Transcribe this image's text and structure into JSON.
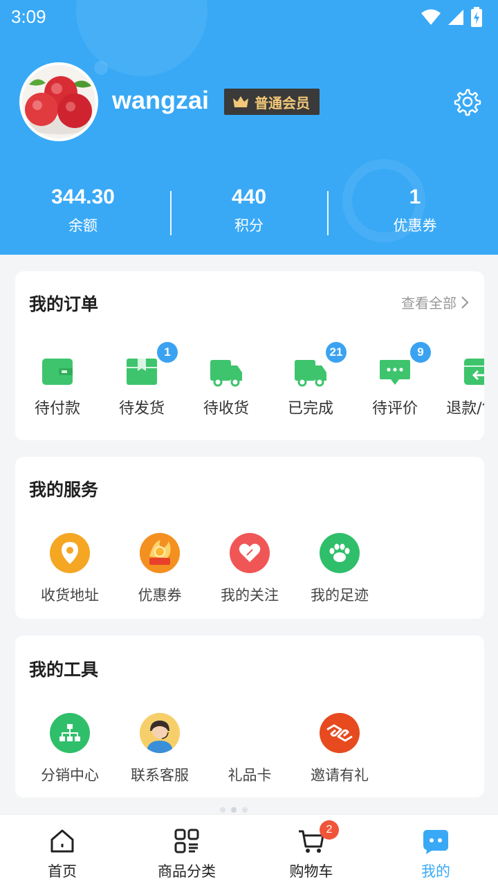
{
  "status_bar": {
    "time": "3:09"
  },
  "profile": {
    "username": "wangzai",
    "member_level": "普通会员"
  },
  "stats": [
    {
      "value": "344.30",
      "label": "余额"
    },
    {
      "value": "440",
      "label": "积分"
    },
    {
      "value": "1",
      "label": "优惠券"
    }
  ],
  "orders": {
    "title": "我的订单",
    "view_all": "查看全部",
    "items": [
      {
        "label": "待付款",
        "icon": "wallet-icon",
        "badge": null
      },
      {
        "label": "待发货",
        "icon": "package-icon",
        "badge": "1"
      },
      {
        "label": "待收货",
        "icon": "truck-icon",
        "badge": null
      },
      {
        "label": "已完成",
        "icon": "truck-done-icon",
        "badge": "21"
      },
      {
        "label": "待评价",
        "icon": "comment-icon",
        "badge": "9"
      },
      {
        "label": "退款/售后",
        "icon": "refund-icon",
        "badge": null
      }
    ]
  },
  "services": {
    "title": "我的服务",
    "items": [
      {
        "label": "收货地址",
        "icon": "location-pin-icon"
      },
      {
        "label": "优惠券",
        "icon": "coupon-icon"
      },
      {
        "label": "我的关注",
        "icon": "heart-icon"
      },
      {
        "label": "我的足迹",
        "icon": "paw-icon"
      }
    ]
  },
  "tools": {
    "title": "我的工具",
    "items": [
      {
        "label": "分销中心",
        "icon": "org-chart-icon"
      },
      {
        "label": "联系客服",
        "icon": "customer-service-icon"
      },
      {
        "label": "礼品卡",
        "icon": "gift-card-icon"
      },
      {
        "label": "邀请有礼",
        "icon": "handshake-icon"
      }
    ]
  },
  "tabbar": {
    "items": [
      {
        "label": "首页",
        "icon": "home-icon"
      },
      {
        "label": "商品分类",
        "icon": "category-icon"
      },
      {
        "label": "购物车",
        "icon": "cart-icon",
        "badge": "2"
      },
      {
        "label": "我的",
        "icon": "profile-chat-icon",
        "active": true
      }
    ]
  },
  "colors": {
    "primary": "#39a9f6",
    "order_green": "#3ec46d",
    "badge_blue": "#3aa2f1",
    "cart_badge": "#f0553a",
    "member_gold": "#f3c878"
  }
}
